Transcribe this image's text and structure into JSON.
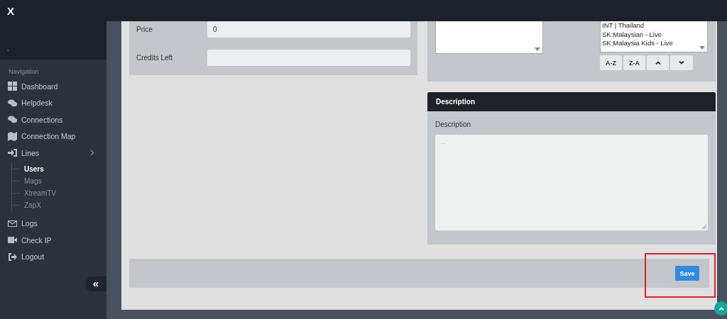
{
  "logo": "X",
  "user_name": ",",
  "sidebar": {
    "heading": "Navigation",
    "items": [
      {
        "label": "Dashboard"
      },
      {
        "label": "Helpdesk"
      },
      {
        "label": "Connections"
      },
      {
        "label": "Connection Map"
      },
      {
        "label": "Lines",
        "children": [
          {
            "label": "Users",
            "selected": true
          },
          {
            "label": "Mags",
            "selected": false
          },
          {
            "label": "XtreamTV",
            "selected": false
          },
          {
            "label": "ZapX",
            "selected": false
          }
        ]
      },
      {
        "label": "Logs"
      },
      {
        "label": "Check IP"
      },
      {
        "label": "Logout"
      }
    ],
    "collapse_button": "«"
  },
  "form": {
    "fields": [
      {
        "label": "Price",
        "value": "0"
      },
      {
        "label": "Credits Left"
      }
    ]
  },
  "bouquets": {
    "list": [
      "INT | Thailand",
      "SK:Malaysian - Live",
      "SK:Malaysia Kids - Live"
    ],
    "buttons": [
      {
        "label": "A-Z",
        "kind": "text"
      },
      {
        "label": "Z-A",
        "kind": "text"
      },
      {
        "kind": "up"
      },
      {
        "kind": "down"
      }
    ]
  },
  "description": {
    "title": "Description",
    "label": "Description",
    "placeholder": "..."
  },
  "save_button": "Save"
}
